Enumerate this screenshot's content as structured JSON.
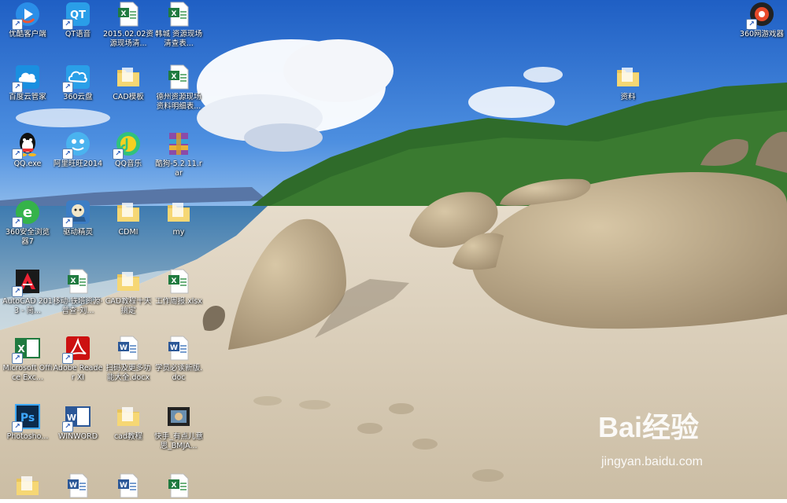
{
  "desktop": {
    "icons": [
      {
        "label": "优酷客户端",
        "icon": "youku-icon",
        "type": "app"
      },
      {
        "label": "QT语音",
        "icon": "qt-voice-icon",
        "type": "app"
      },
      {
        "label": "2015.02.02资源现场清...",
        "icon": "excel-file-icon",
        "type": "excel"
      },
      {
        "label": "韩城 资源现场清查表...",
        "icon": "excel-file-icon",
        "type": "excel"
      },
      {
        "label": "百度云管家",
        "icon": "baidu-cloud-icon",
        "type": "app"
      },
      {
        "label": "360云盘",
        "icon": "360-cloud-icon",
        "type": "app"
      },
      {
        "label": "CAD模板",
        "icon": "folder-icon",
        "type": "folder"
      },
      {
        "label": "德州资源现场资料明细表...",
        "icon": "excel-file-icon",
        "type": "excel"
      },
      {
        "label": "QQ.exe",
        "icon": "qq-icon",
        "type": "app"
      },
      {
        "label": "阿里旺旺2014",
        "icon": "aliwangwang-icon",
        "type": "app"
      },
      {
        "label": "QQ音乐",
        "icon": "qq-music-icon",
        "type": "app"
      },
      {
        "label": "酷狗-5.2.11.rar",
        "icon": "rar-archive-icon",
        "type": "rar"
      },
      {
        "label": "360安全浏览器7",
        "icon": "360-browser-icon",
        "type": "app"
      },
      {
        "label": "驱动精灵",
        "icon": "driver-genius-icon",
        "type": "app"
      },
      {
        "label": "CDMI",
        "icon": "folder-icon",
        "type": "folder"
      },
      {
        "label": "my",
        "icon": "folder-icon",
        "type": "folder"
      },
      {
        "label": "AutoCAD 2013 - 简...",
        "icon": "autocad-icon",
        "type": "app"
      },
      {
        "label": "移动-铁塔资源-普查-刘...",
        "icon": "excel-file-icon",
        "type": "excel"
      },
      {
        "label": "CAD教程十天搞定",
        "icon": "folder-icon",
        "type": "folder"
      },
      {
        "label": "工作周报.xlsx",
        "icon": "excel-file-icon",
        "type": "excel"
      },
      {
        "label": "Microsoft Office Exc...",
        "icon": "excel-app-icon",
        "type": "app"
      },
      {
        "label": "Adobe Reader XI",
        "icon": "adobe-reader-icon",
        "type": "app"
      },
      {
        "label": "扫码及更多功能大全.docx",
        "icon": "word-file-icon",
        "type": "word"
      },
      {
        "label": "学员必读新版.doc",
        "icon": "word-file-icon",
        "type": "word"
      },
      {
        "label": "Photosho...",
        "icon": "photoshop-icon",
        "type": "app"
      },
      {
        "label": "WINWORD",
        "icon": "word-app-icon",
        "type": "app"
      },
      {
        "label": "cad教程",
        "icon": "folder-icon",
        "type": "folder"
      },
      {
        "label": "快手_有点儿意思_BMJA...",
        "icon": "video-file-icon",
        "type": "video"
      },
      {
        "label": "",
        "icon": "folder-icon",
        "type": "folder"
      },
      {
        "label": "",
        "icon": "word-file-icon",
        "type": "word"
      },
      {
        "label": "",
        "icon": "word-file-icon",
        "type": "word"
      },
      {
        "label": "",
        "icon": "excel-file-icon",
        "type": "excel"
      },
      {
        "label": "资料",
        "icon": "folder-icon",
        "type": "folder"
      },
      {
        "label": "360网游戏器",
        "icon": "360-game-icon",
        "type": "app"
      }
    ]
  },
  "watermark": {
    "logo_text": "Bai经验",
    "url": "jingyan.baidu.com"
  },
  "colors": {
    "sky": "#3f7fd6",
    "sea": "#2a5a8a",
    "sand": "#d9ccb6",
    "hill": "#2f6b2a"
  }
}
